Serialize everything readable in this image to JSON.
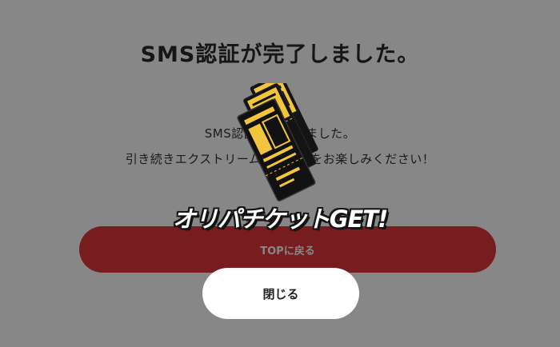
{
  "page": {
    "title": "SMS認証が完了しました。",
    "message_line1": "SMS認証が完了しました。",
    "message_line2": "引き続きエクストリームサービスをお楽しみください！",
    "top_button_label": "TOPに戻る",
    "top_button_color": "#e0383e"
  },
  "modal": {
    "reward_title": "オリパチケットGET!",
    "close_button_label": "閉じる",
    "ticket_icon": "ticket-icon",
    "ticket_color": "#f2c53d"
  }
}
